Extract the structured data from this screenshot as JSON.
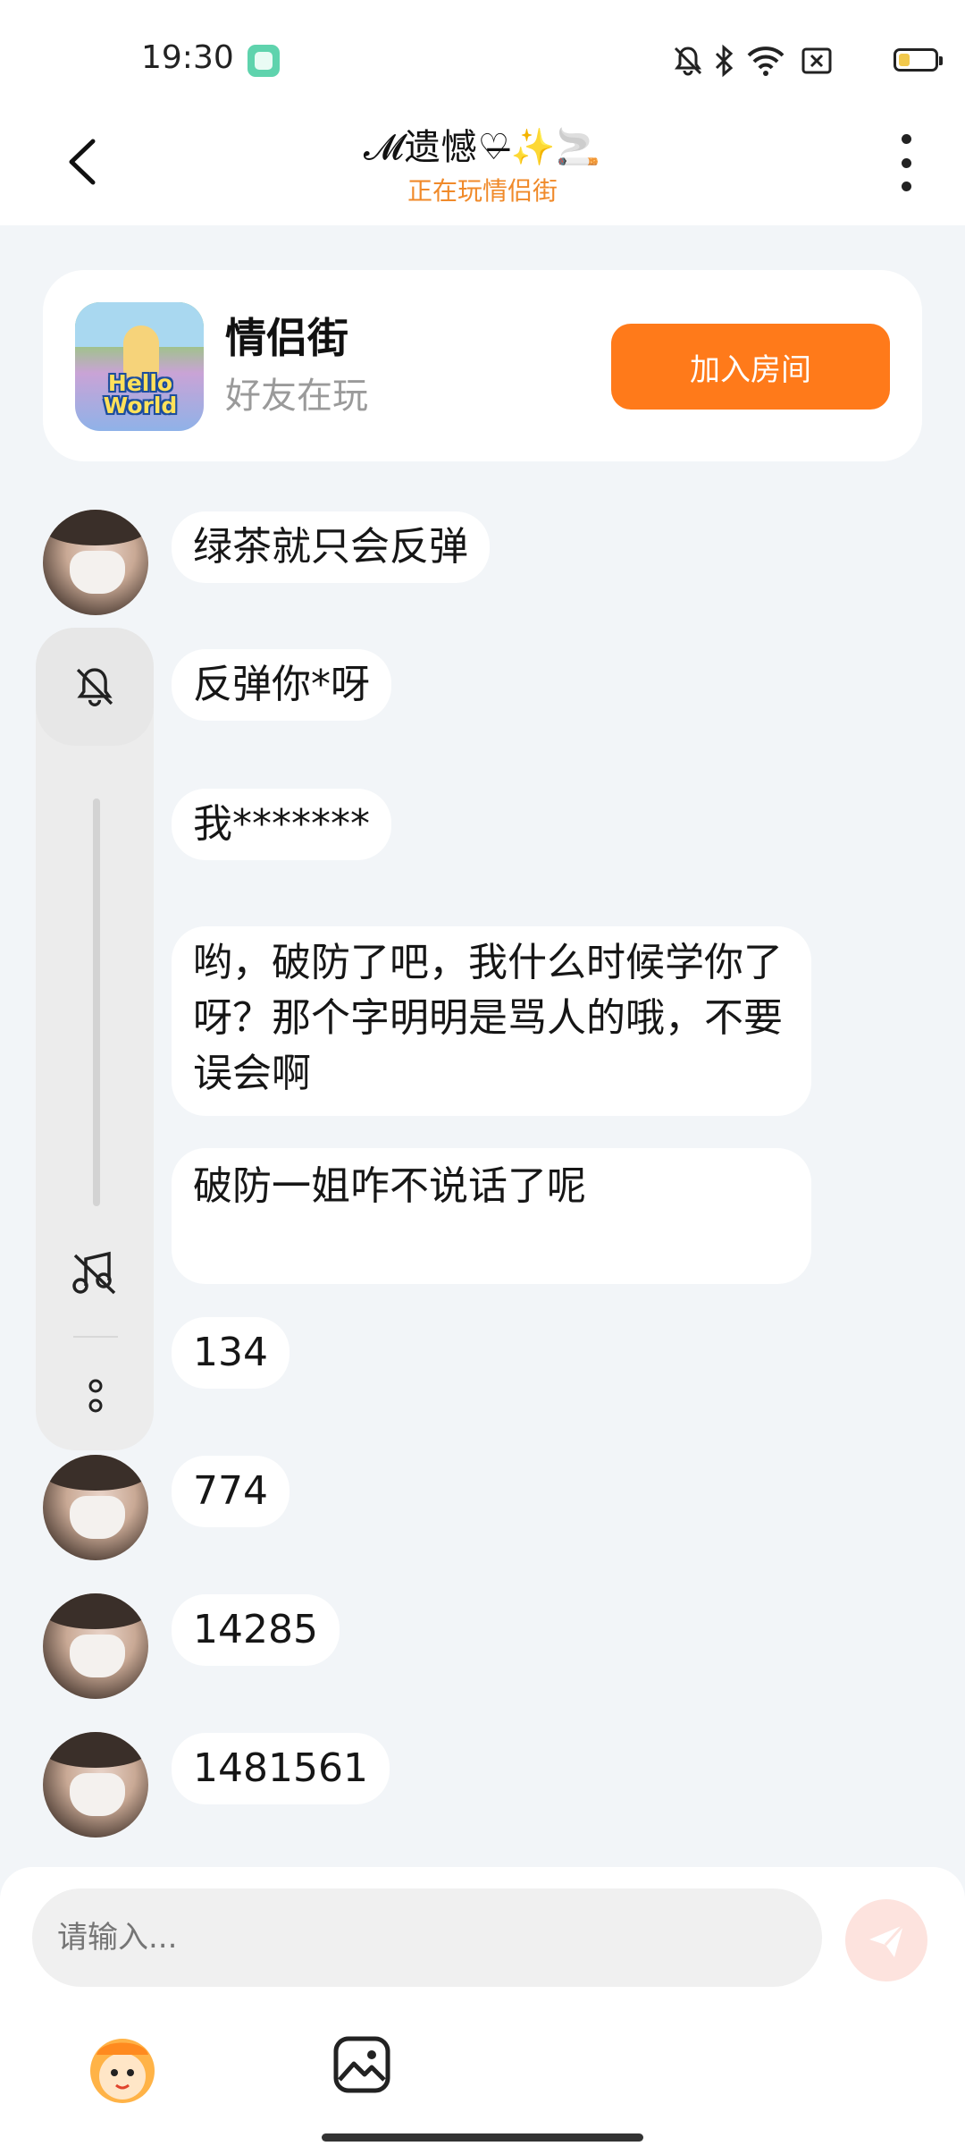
{
  "status_bar": {
    "time": "19:30",
    "battery_level": 0.3
  },
  "header": {
    "title": "𝓜遗憾♡̶✨🚬",
    "subtitle": "正在玩情侣街"
  },
  "game_card": {
    "name": "情侣街",
    "status": "好友在玩",
    "join_label": "加入房间",
    "icon_text": "Hello World"
  },
  "messages": [
    {
      "text": "绿茶就只会反弹",
      "avatar": true
    },
    {
      "text": "反弹你*呀",
      "avatar": true
    },
    {
      "text": "我*******",
      "avatar": true
    },
    {
      "text": "哟，破防了吧，我什么时候学你了呀？那个字明明是骂人的哦，不要误会啊",
      "avatar": false
    },
    {
      "text": "破防一姐咋不说话了呢",
      "avatar": false
    },
    {
      "text": "134",
      "avatar": true
    },
    {
      "text": "774",
      "avatar": true
    },
    {
      "text": "14285",
      "avatar": true
    },
    {
      "text": "1481561",
      "avatar": true
    }
  ],
  "input": {
    "placeholder": "请输入..."
  },
  "colors": {
    "accent": "#ff7a1a",
    "subtitle": "#f08a2a",
    "background": "#f2f5f8"
  }
}
